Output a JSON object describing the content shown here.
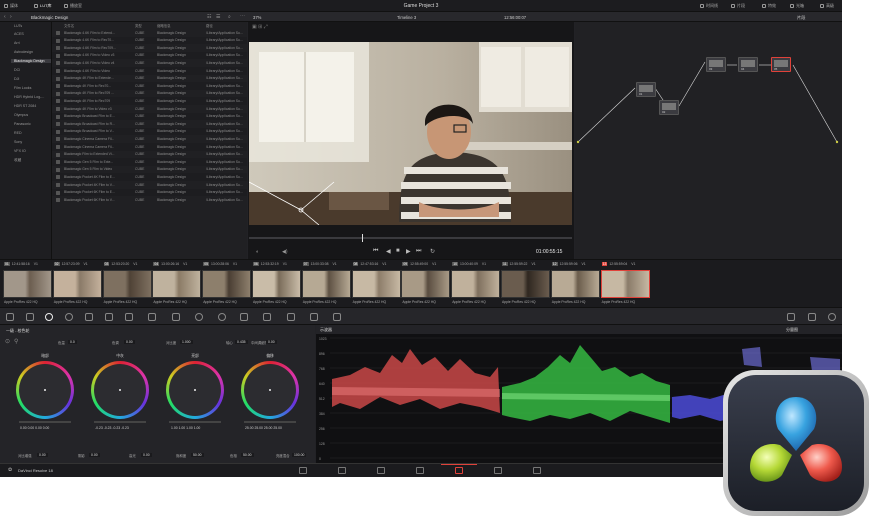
{
  "topbar": {
    "left_items": [
      "媒体",
      "LUT库",
      "播放室"
    ],
    "title": "Game Project 3",
    "right_items": [
      "时间线",
      "片段",
      "光箱",
      "特效",
      "高级"
    ],
    "far_right": "光箱"
  },
  "bar2": {
    "folder_title": "Blackmagic Design",
    "zoom": "37%",
    "timeline": "Timeline 3",
    "timecode": "12:56:00:07",
    "clip_mode": "片段"
  },
  "lut_sidebar": {
    "header": "LUTs",
    "items": [
      "ACES",
      "Arri",
      "Astrodesign",
      "Blackmagic Design",
      "DCI",
      "DJI",
      "Film Looks",
      "HDR Hybrid Log-...",
      "HDR ST 2084",
      "Olympus",
      "Panasonic",
      "RED",
      "Sony",
      "VFX IO",
      "收藏"
    ],
    "selected": "Blackmagic Design"
  },
  "lut_list": {
    "columns": [
      "文件名",
      "类型",
      "缩略信息",
      "路径"
    ],
    "rows": [
      [
        "Blackmagic 4.6K Film to Extend...",
        "CUBE",
        "Blackmagic Design",
        "/Library/Application Su..."
      ],
      [
        "Blackmagic 4.6K Film to Rec70...",
        "CUBE",
        "Blackmagic Design",
        "/Library/Application Su..."
      ],
      [
        "Blackmagic 4.6K Film to Rec709...",
        "CUBE",
        "Blackmagic Design",
        "/Library/Application Su..."
      ],
      [
        "Blackmagic 4.6K Film to Video v3",
        "CUBE",
        "Blackmagic Design",
        "/Library/Application Su..."
      ],
      [
        "Blackmagic 4.6K Film to Video v4",
        "CUBE",
        "Blackmagic Design",
        "/Library/Application Su..."
      ],
      [
        "Blackmagic 4.6K Film to Video",
        "CUBE",
        "Blackmagic Design",
        "/Library/Application Su..."
      ],
      [
        "Blackmagic 4K Film to Extende...",
        "CUBE",
        "Blackmagic Design",
        "/Library/Application Su..."
      ],
      [
        "Blackmagic 4K Film to Rec70...",
        "CUBE",
        "Blackmagic Design",
        "/Library/Application Su..."
      ],
      [
        "Blackmagic 4K Film to Rec709 ...",
        "CUBE",
        "Blackmagic Design",
        "/Library/Application Su..."
      ],
      [
        "Blackmagic 4K Film to Rec709",
        "CUBE",
        "Blackmagic Design",
        "/Library/Application Su..."
      ],
      [
        "Blackmagic 4K Film to Video v3",
        "CUBE",
        "Blackmagic Design",
        "/Library/Application Su..."
      ],
      [
        "Blackmagic Broadcast Film to E...",
        "CUBE",
        "Blackmagic Design",
        "/Library/Application Su..."
      ],
      [
        "Blackmagic Broadcast Film to R...",
        "CUBE",
        "Blackmagic Design",
        "/Library/Application Su..."
      ],
      [
        "Blackmagic Broadcast Film to V...",
        "CUBE",
        "Blackmagic Design",
        "/Library/Application Su..."
      ],
      [
        "Blackmagic Cinema Camera Fil...",
        "CUBE",
        "Blackmagic Design",
        "/Library/Application Su..."
      ],
      [
        "Blackmagic Cinema Camera Fil...",
        "CUBE",
        "Blackmagic Design",
        "/Library/Application Su..."
      ],
      [
        "Blackmagic Film to Extended Vi...",
        "CUBE",
        "Blackmagic Design",
        "/Library/Application Su..."
      ],
      [
        "Blackmagic Gen 5 Film to Exte...",
        "CUBE",
        "Blackmagic Design",
        "/Library/Application Su..."
      ],
      [
        "Blackmagic Gen 5 Film to Video",
        "CUBE",
        "Blackmagic Design",
        "/Library/Application Su..."
      ],
      [
        "Blackmagic Pocket 4K Film to E...",
        "CUBE",
        "Blackmagic Design",
        "/Library/Application Su..."
      ],
      [
        "Blackmagic Pocket 4K Film to V...",
        "CUBE",
        "Blackmagic Design",
        "/Library/Application Su..."
      ],
      [
        "Blackmagic Pocket 6K Film to E...",
        "CUBE",
        "Blackmagic Design",
        "/Library/Application Su..."
      ],
      [
        "Blackmagic Pocket 6K Film to V...",
        "CUBE",
        "Blackmagic Design",
        "/Library/Application Su..."
      ]
    ]
  },
  "viewer": {
    "timecode": "01:00:55:15"
  },
  "nodes": [
    "01",
    "02",
    "03",
    "04",
    "05"
  ],
  "clips": [
    {
      "num": "01",
      "tc": "12:41:58:16",
      "track": "V1",
      "codec": "Apple ProRes 422 HQ"
    },
    {
      "num": "02",
      "tc": "12:57:23:09",
      "track": "V1",
      "codec": "Apple ProRes 422 HQ"
    },
    {
      "num": "03",
      "tc": "12:53:20:20",
      "track": "V1",
      "codec": "Apple ProRes 422 HQ"
    },
    {
      "num": "04",
      "tc": "13:00:26:16",
      "track": "V1",
      "codec": "Apple ProRes 422 HQ"
    },
    {
      "num": "05",
      "tc": "13:00:28:06",
      "track": "V1",
      "codec": "Apple ProRes 422 HQ"
    },
    {
      "num": "06",
      "tc": "12:53:32:19",
      "track": "V1",
      "codec": "Apple ProRes 422 HQ"
    },
    {
      "num": "07",
      "tc": "13:00:33:08",
      "track": "V1",
      "codec": "Apple ProRes 422 HQ"
    },
    {
      "num": "08",
      "tc": "12:47:53:16",
      "track": "V1",
      "codec": "Apple ProRes 422 HQ"
    },
    {
      "num": "09",
      "tc": "12:55:49:00",
      "track": "V1",
      "codec": "Apple ProRes 422 HQ"
    },
    {
      "num": "10",
      "tc": "13:00:40:09",
      "track": "V1",
      "codec": "Apple ProRes 422 HQ"
    },
    {
      "num": "11",
      "tc": "12:55:59:22",
      "track": "V1",
      "codec": "Apple ProRes 422 HQ"
    },
    {
      "num": "12",
      "tc": "12:55:59:06",
      "track": "V1",
      "codec": "Apple ProRes 422 HQ"
    },
    {
      "num": "13",
      "tc": "12:55:59:04",
      "track": "V1",
      "codec": "Apple ProRes 422 HQ"
    }
  ],
  "color_panel": {
    "title": "一级 - 校色轮",
    "top_params": [
      {
        "label": "色温",
        "value": "0.0"
      },
      {
        "label": "色调",
        "value": "0.00"
      },
      {
        "label": "对比度",
        "value": "1.000"
      },
      {
        "label": "轴心",
        "value": "0.435"
      },
      {
        "label": "中间调细节",
        "value": "0.00"
      }
    ],
    "wheels": [
      {
        "label": "暗部",
        "values": [
          "0.00",
          "0.00",
          "0.00",
          "0.00"
        ]
      },
      {
        "label": "中灰",
        "values": [
          "-0.23",
          "-0.23",
          "-0.23",
          "-0.23"
        ]
      },
      {
        "label": "亮部",
        "values": [
          "1.00",
          "1.00",
          "1.00",
          "1.00"
        ]
      },
      {
        "label": "偏移",
        "values": [
          "25.00",
          "25.00",
          "25.00",
          "25.00"
        ]
      }
    ],
    "bottom_params": [
      {
        "label": "对比增强",
        "value": "0.00"
      },
      {
        "label": "阴影",
        "value": "0.00"
      },
      {
        "label": "高光",
        "value": "0.00"
      },
      {
        "label": "饱和度",
        "value": "50.00"
      },
      {
        "label": "色相",
        "value": "50.00"
      },
      {
        "label": "亮度混合",
        "value": "100.00"
      }
    ]
  },
  "scope": {
    "title": "示波器",
    "mode": "分量图",
    "scale": [
      "1023",
      "896",
      "768",
      "640",
      "512",
      "384",
      "256",
      "128",
      "0"
    ]
  },
  "bottom": {
    "app_name": "DaVinci Resolve 18"
  },
  "colors": {
    "accent": "#e0423a",
    "panel": "#222226",
    "red_trace": "#e05a5a",
    "green_trace": "#3bd24a",
    "blue_trace": "#5a5ae6"
  }
}
